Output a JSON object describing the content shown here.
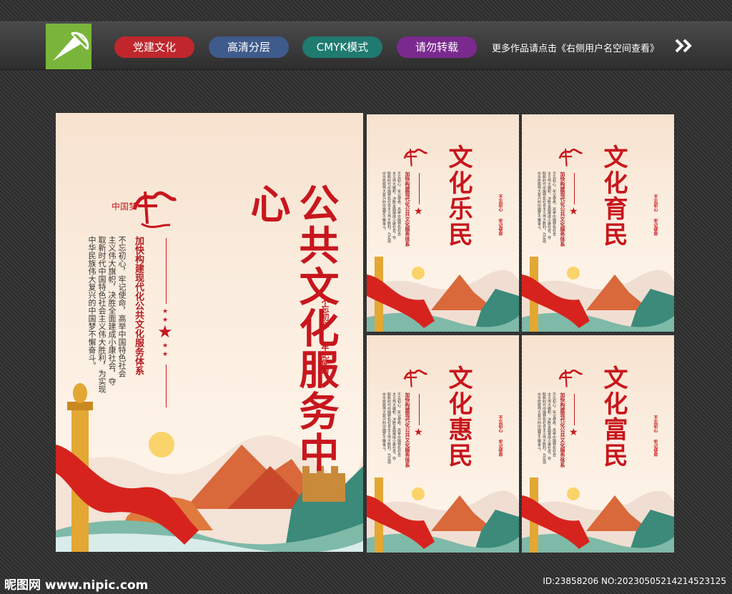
{
  "topbar": {
    "tags": [
      {
        "label": "党建文化",
        "color": "#c0272d"
      },
      {
        "label": "高清分层",
        "color": "#3f5b8c"
      },
      {
        "label": "CMYK模式",
        "color": "#1f7a70"
      },
      {
        "label": "请勿转载",
        "color": "#7a2a8e"
      }
    ],
    "promo": "更多作品请点击《右侧用户名空间查看》"
  },
  "main_poster": {
    "logo_text": "中国梦",
    "title": "公共文化服务中心",
    "subhead": "加快构建现代化公共文化服务体系",
    "body_lines": [
      "不忘初心，牢记使命，高举中国特色社会",
      "主义伟大旗帜，决胜全面建成小康社会，夺",
      "取新时代中国特色社会主义伟大胜利，为实现",
      "中华民族伟大复兴的中国梦不懈奋斗。"
    ],
    "slogans": [
      "不忘初心",
      "牢记使命"
    ]
  },
  "small_posters": [
    {
      "title": "文化乐民"
    },
    {
      "title": "文化育民"
    },
    {
      "title": "文化惠民"
    },
    {
      "title": "文化富民"
    }
  ],
  "small_common": {
    "logo_text": "中国梦",
    "subhead": "加快构建现代化公共文化服务体系",
    "body_lines": [
      "不忘初心，牢记使命，高举中国特色社会",
      "主义伟大旗帜，决胜全面建成小康社会，夺",
      "取新时代中国特色社会主义伟大胜利，为实现",
      "中华民族伟大复兴的中国梦不懈奋斗。"
    ],
    "slogans": [
      "不忘初心",
      "牢记使命"
    ]
  },
  "footer": {
    "site": "昵图网 www.nipic.com",
    "id": "ID:23858206 NO:20230505214214523125"
  },
  "colors": {
    "brand_red": "#c8161d",
    "logo_green": "#7ab53b"
  }
}
